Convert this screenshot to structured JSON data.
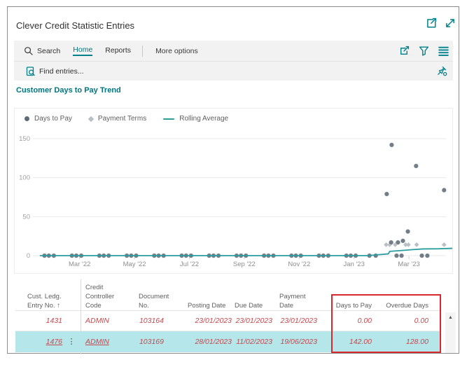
{
  "page": {
    "title": "Clever Credit Statistic Entries"
  },
  "toolbar": {
    "search_label": "Search",
    "tabs": [
      {
        "label": "Home",
        "active": true
      },
      {
        "label": "Reports",
        "active": false
      }
    ],
    "more_options_label": "More options"
  },
  "findbar": {
    "label": "Find entries..."
  },
  "section_heading": "Customer Days to Pay Trend",
  "icons": {
    "scroll_up": "▲",
    "row_ellipsis": "⋮"
  },
  "chart_data": {
    "type": "scatter",
    "title": "Customer Days to Pay Trend",
    "grid": true,
    "legend_position": "top-left",
    "x_axis": {
      "unit": "months (0 = Feb 2022)",
      "range": [
        -0.6,
        14.6
      ],
      "ticks": [
        {
          "x": 1,
          "label": "Mar '22"
        },
        {
          "x": 3,
          "label": "May '22"
        },
        {
          "x": 5,
          "label": "Jul '22"
        },
        {
          "x": 7,
          "label": "Sep '22"
        },
        {
          "x": 9,
          "label": "Nov '22"
        },
        {
          "x": 11,
          "label": "Jan '23"
        },
        {
          "x": 13,
          "label": "Mar '23"
        }
      ]
    },
    "y_axis": {
      "range": [
        0,
        160
      ],
      "ticks": [
        0,
        50,
        100,
        150
      ]
    },
    "series": [
      {
        "name": "Days to Pay",
        "type": "scatter",
        "marker": "circle",
        "color": "#5e6b76",
        "points": [
          [
            -0.28,
            0
          ],
          [
            -0.12,
            0
          ],
          [
            0.06,
            0
          ],
          [
            0.72,
            0
          ],
          [
            0.88,
            0
          ],
          [
            1.06,
            0
          ],
          [
            1.72,
            0
          ],
          [
            1.88,
            0
          ],
          [
            2.06,
            0
          ],
          [
            2.72,
            0
          ],
          [
            2.88,
            0
          ],
          [
            3.06,
            0
          ],
          [
            3.72,
            0
          ],
          [
            3.88,
            0
          ],
          [
            4.06,
            0
          ],
          [
            4.72,
            0
          ],
          [
            4.88,
            0
          ],
          [
            5.06,
            0
          ],
          [
            5.72,
            0
          ],
          [
            5.88,
            0
          ],
          [
            6.06,
            0
          ],
          [
            6.72,
            0
          ],
          [
            6.88,
            0
          ],
          [
            7.06,
            0
          ],
          [
            7.72,
            0
          ],
          [
            7.88,
            0
          ],
          [
            8.06,
            0
          ],
          [
            8.72,
            0
          ],
          [
            8.88,
            0
          ],
          [
            9.06,
            0
          ],
          [
            9.72,
            0
          ],
          [
            9.88,
            0
          ],
          [
            10.06,
            0
          ],
          [
            10.72,
            0
          ],
          [
            10.88,
            0
          ],
          [
            11.06,
            0
          ],
          [
            11.56,
            0
          ],
          [
            11.79,
            0
          ],
          [
            12.19,
            79
          ],
          [
            12.35,
            17
          ],
          [
            12.37,
            142
          ],
          [
            12.55,
            0
          ],
          [
            12.6,
            17
          ],
          [
            12.73,
            0
          ],
          [
            12.78,
            19
          ],
          [
            12.96,
            31
          ],
          [
            13.26,
            115
          ],
          [
            13.47,
            0
          ],
          [
            13.67,
            0
          ],
          [
            14.28,
            84
          ]
        ]
      },
      {
        "name": "Payment Terms",
        "type": "scatter",
        "marker": "diamond",
        "color": "#b9bfc4",
        "points": [
          [
            12.17,
            14
          ],
          [
            12.3,
            14
          ],
          [
            12.5,
            14
          ],
          [
            12.88,
            14
          ],
          [
            12.98,
            14
          ],
          [
            13.28,
            14
          ],
          [
            14.28,
            14
          ]
        ]
      },
      {
        "name": "Rolling Average",
        "type": "line",
        "color": "#2a9da0",
        "points": [
          [
            -0.45,
            0
          ],
          [
            11.5,
            0
          ],
          [
            11.9,
            1.2
          ],
          [
            12.25,
            2.3
          ],
          [
            12.3,
            5.5
          ],
          [
            12.7,
            6.5
          ],
          [
            13.1,
            7.6
          ],
          [
            13.5,
            8.6
          ],
          [
            14.1,
            8.8
          ],
          [
            14.6,
            9.4
          ]
        ]
      }
    ]
  },
  "table": {
    "columns": [
      {
        "id": "entry_no",
        "label_lines": [
          "Cust. Ledg.",
          "Entry No. ↑"
        ]
      },
      {
        "id": "credit_controller_code",
        "label_lines": [
          "Credit",
          "Controller",
          "Code"
        ]
      },
      {
        "id": "document_no",
        "label_lines": [
          "Document",
          "No."
        ]
      },
      {
        "id": "posting_date",
        "label_lines": [
          "Posting Date"
        ]
      },
      {
        "id": "due_date",
        "label_lines": [
          "Due Date"
        ]
      },
      {
        "id": "payment_date",
        "label_lines": [
          "Payment",
          "Date"
        ]
      },
      {
        "id": "days_to_pay",
        "label_lines": [
          "Days to Pay"
        ]
      },
      {
        "id": "overdue_days",
        "label_lines": [
          "Overdue Days"
        ]
      }
    ],
    "rows": [
      {
        "entry_no": "1431",
        "credit_controller_code": "ADMIN",
        "document_no": "103164",
        "posting_date": "23/01/2023",
        "due_date": "23/01/2023",
        "payment_date": "23/01/2023",
        "days_to_pay": "0.00",
        "overdue_days": "0.00",
        "selected": false,
        "links": []
      },
      {
        "entry_no": "1476",
        "credit_controller_code": "ADMIN",
        "document_no": "103169",
        "posting_date": "28/01/2023",
        "due_date": "11/02/2023",
        "payment_date": "19/06/2023",
        "days_to_pay": "142.00",
        "overdue_days": "128.00",
        "selected": true,
        "links": [
          "entry_no",
          "credit_controller_code"
        ]
      }
    ]
  },
  "annotation": {
    "box_color": "#d9272e",
    "highlighted_columns": [
      "Days to Pay",
      "Overdue Days"
    ]
  },
  "colors": {
    "accent": "#00828c",
    "selected_row": "#b4e6ea",
    "value_text": "#c5494e",
    "toolbar_bg": "#f2f2f2",
    "frame_border": "#8c8c8c"
  }
}
